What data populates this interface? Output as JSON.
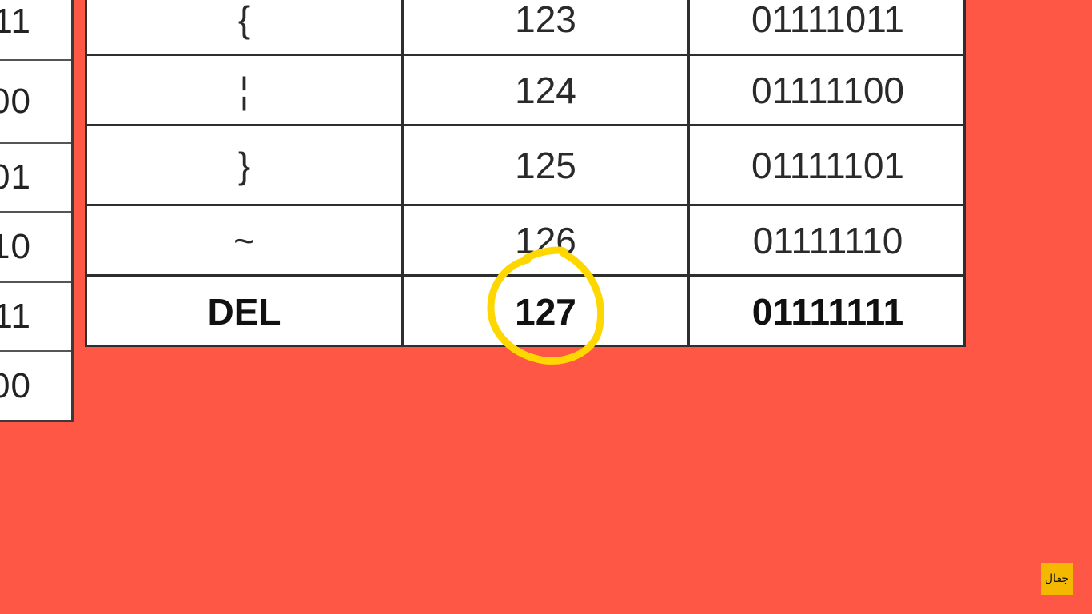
{
  "left_table": {
    "cells": [
      "11",
      "00",
      "01",
      "10",
      "11",
      "00"
    ]
  },
  "main_table": {
    "rows": [
      {
        "char": "{",
        "decimal": "123",
        "binary": "01111011"
      },
      {
        "char": "¦",
        "decimal": "124",
        "binary": "01111100"
      },
      {
        "char": "}",
        "decimal": "125",
        "binary": "01111101"
      },
      {
        "char": "~",
        "decimal": "126",
        "binary": "01111110"
      },
      {
        "char": "DEL",
        "decimal": "127",
        "binary": "01111111"
      }
    ]
  },
  "annotation": {
    "color": "#ffd700",
    "circled_value": "127"
  },
  "logo": {
    "text": "جقال"
  },
  "colors": {
    "background": "#ff5745",
    "highlight_circle": "#ffd700",
    "logo_badge": "#f5b800"
  }
}
